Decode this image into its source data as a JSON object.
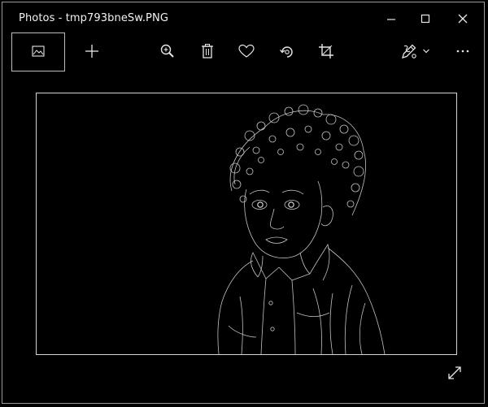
{
  "window": {
    "title": "Photos - tmp793bneSw.PNG"
  },
  "titlebar_buttons": [
    {
      "name": "minimize-icon",
      "label": "Minimize"
    },
    {
      "name": "maximize-icon",
      "label": "Maximize"
    },
    {
      "name": "close-icon",
      "label": "Close"
    }
  ],
  "toolbar": {
    "left": [
      {
        "name": "see-all-photos-icon"
      },
      {
        "name": "add-icon"
      }
    ],
    "center": [
      {
        "name": "zoom-icon"
      },
      {
        "name": "delete-icon"
      },
      {
        "name": "favorite-icon"
      },
      {
        "name": "rotate-icon"
      },
      {
        "name": "crop-icon"
      }
    ],
    "right": [
      {
        "name": "edit-draw-icon"
      },
      {
        "name": "chevron-down-icon"
      },
      {
        "name": "more-icon"
      }
    ]
  },
  "image": {
    "description_hidden": "",
    "style": "edge-detected portrait on black"
  },
  "colors": {
    "background": "#000000",
    "frame": "#d4d4d4",
    "icon": "#e6e6e6"
  }
}
